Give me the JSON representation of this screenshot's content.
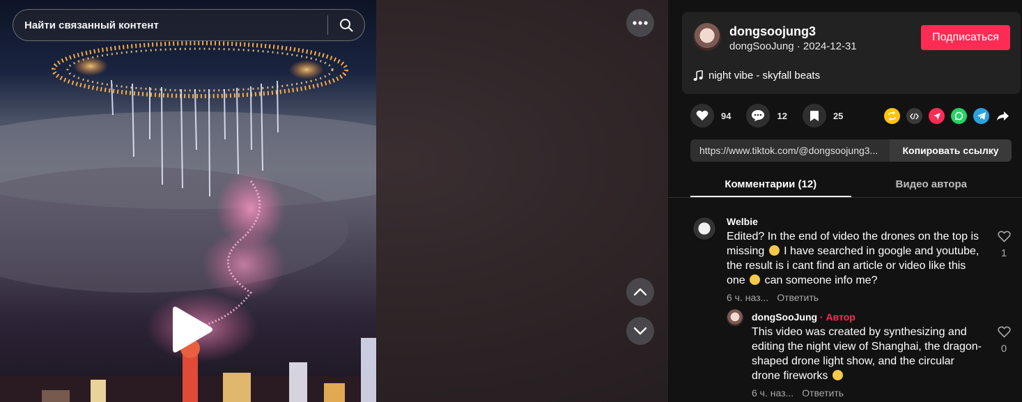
{
  "search": {
    "placeholder": "Найти связанный контент"
  },
  "author": {
    "username": "dongsoojung3",
    "subline": "dongSooJung · 2024-12-31",
    "follow_label": "Подписаться",
    "music": "night vibe - skyfall beats"
  },
  "actions": {
    "likes": "94",
    "comments": "12",
    "saves": "25"
  },
  "share_icons": [
    "repost-icon",
    "embed-icon",
    "send-icon",
    "whatsapp-icon",
    "telegram-icon",
    "share-arrow-icon"
  ],
  "link": {
    "url": "https://www.tiktok.com/@dongsoojung3...",
    "copy_label": "Копировать ссылку"
  },
  "tabs": [
    {
      "label": "Комментарии (12)",
      "active": true
    },
    {
      "label": "Видео автора",
      "active": false
    }
  ],
  "comments": [
    {
      "name": "Welbie",
      "text_parts": [
        "Edited? In the end of video the drones on the top is missing ",
        " I have searched in google and youtube, the result is i cant find an article or video like this one ",
        " can someone info me?"
      ],
      "time": "6 ч. наз...",
      "reply_label": "Ответить",
      "likes": "1",
      "emojis": [
        "grinning-sweat-emoji",
        "joy-emoji"
      ]
    },
    {
      "name": "dongSooJung",
      "author_tag": "· Автор",
      "text_parts": [
        "This video was created by synthesizing and editing the night view of Shanghai, the dragon-shaped drone light show, and the circular drone fireworks ",
        ""
      ],
      "time": "6 ч. наз...",
      "reply_label": "Ответить",
      "likes": "0",
      "emojis": [
        "grinning-emoji"
      ]
    }
  ],
  "colors": {
    "accent": "#fe2c55",
    "panel": "#121212",
    "card": "#222222"
  }
}
